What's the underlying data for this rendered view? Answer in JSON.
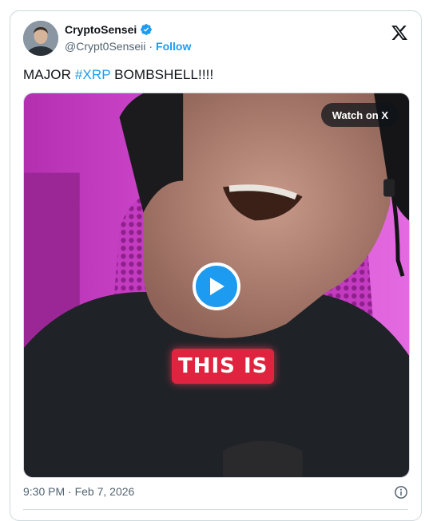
{
  "author": {
    "name": "CryptoSensei",
    "handle": "@Crypt0Senseii",
    "separator": "·",
    "follow_label": "Follow",
    "verified_color": "#1d9bf0",
    "avatar_icon": "profile-photo"
  },
  "tweet": {
    "text_prefix": "MAJOR ",
    "hashtag": "#XRP",
    "text_suffix": " BOMBSHELL!!!!"
  },
  "media": {
    "watch_label": "Watch on X",
    "caption": "THIS IS",
    "play_icon": "play-icon",
    "caption_color": "#e0233e"
  },
  "footer": {
    "timestamp": "9:30 PM · Feb 7, 2026",
    "info_icon": "info-icon"
  },
  "colors": {
    "accent": "#1d9bf0",
    "text": "#0f1419",
    "muted": "#536471",
    "border": "#cfd9de"
  }
}
